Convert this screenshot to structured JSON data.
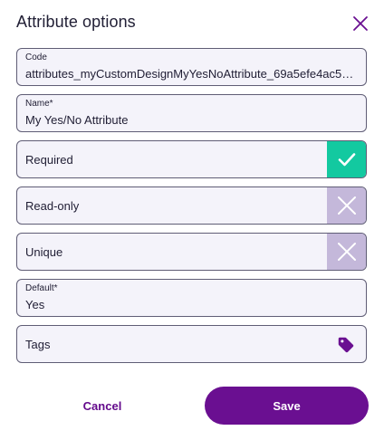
{
  "dialog": {
    "title": "Attribute options",
    "close_icon": "close-icon"
  },
  "fields": {
    "code": {
      "label": "Code",
      "value": "attributes_myCustomDesignMyYesNoAttribute_69a5efe4ac512..."
    },
    "name": {
      "label": "Name*",
      "value": "My Yes/No Attribute"
    },
    "required": {
      "label": "Required",
      "checked": true
    },
    "read_only": {
      "label": "Read-only",
      "checked": false
    },
    "unique": {
      "label": "Unique",
      "checked": false
    },
    "default": {
      "label": "Default*",
      "value": "Yes"
    },
    "tags": {
      "label": "Tags",
      "icon": "tag-icon"
    }
  },
  "actions": {
    "cancel_label": "Cancel",
    "save_label": "Save"
  },
  "colors": {
    "accent": "#6a0f91",
    "toggle_on": "#13c9a0",
    "toggle_off": "#c4b8da",
    "field_bg": "#f4f3fa",
    "field_border": "#5f5d75"
  }
}
